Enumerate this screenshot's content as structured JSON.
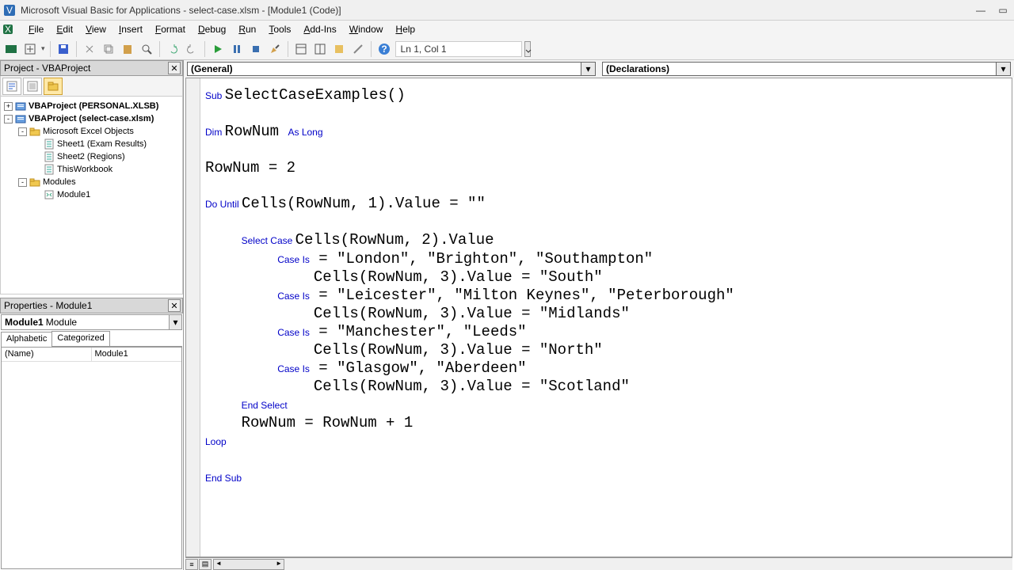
{
  "title": "Microsoft Visual Basic for Applications - select-case.xlsm - [Module1 (Code)]",
  "menus": [
    "File",
    "Edit",
    "View",
    "Insert",
    "Format",
    "Debug",
    "Run",
    "Tools",
    "Add-Ins",
    "Window",
    "Help"
  ],
  "cursor_position": "Ln 1, Col 1",
  "project_panel_title": "Project - VBAProject",
  "properties_panel_title": "Properties - Module1",
  "properties_object": {
    "name": "Module1",
    "type": "Module"
  },
  "properties_tabs": [
    "Alphabetic",
    "Categorized"
  ],
  "properties_rows": [
    {
      "key": "(Name)",
      "val": "Module1"
    }
  ],
  "tree": [
    {
      "indent": 0,
      "toggle": "+",
      "icon": "project",
      "label": "VBAProject (PERSONAL.XLSB)",
      "bold": true
    },
    {
      "indent": 0,
      "toggle": "-",
      "icon": "project",
      "label": "VBAProject (select-case.xlsm)",
      "bold": true
    },
    {
      "indent": 1,
      "toggle": "-",
      "icon": "folder",
      "label": "Microsoft Excel Objects",
      "bold": false
    },
    {
      "indent": 2,
      "toggle": "",
      "icon": "sheet",
      "label": "Sheet1 (Exam Results)",
      "bold": false
    },
    {
      "indent": 2,
      "toggle": "",
      "icon": "sheet",
      "label": "Sheet2 (Regions)",
      "bold": false
    },
    {
      "indent": 2,
      "toggle": "",
      "icon": "sheet",
      "label": "ThisWorkbook",
      "bold": false
    },
    {
      "indent": 1,
      "toggle": "-",
      "icon": "folder",
      "label": "Modules",
      "bold": false
    },
    {
      "indent": 2,
      "toggle": "",
      "icon": "module",
      "label": "Module1",
      "bold": false
    }
  ],
  "code_scope_left": "(General)",
  "code_scope_right": "(Declarations)",
  "code": {
    "lines": [
      [
        {
          "t": "Sub ",
          "k": true
        },
        {
          "t": "SelectCaseExamples()"
        }
      ],
      [
        {
          "t": ""
        }
      ],
      [
        {
          "t": "Dim ",
          "k": true
        },
        {
          "t": "RowNum "
        },
        {
          "t": "As Long",
          "k": true
        }
      ],
      [
        {
          "t": ""
        }
      ],
      [
        {
          "t": "RowNum = 2"
        }
      ],
      [
        {
          "t": ""
        }
      ],
      [
        {
          "t": "Do Until ",
          "k": true
        },
        {
          "t": "Cells(RowNum, 1).Value = \"\""
        }
      ],
      [
        {
          "t": ""
        }
      ],
      [
        {
          "t": "    "
        },
        {
          "t": "Select Case ",
          "k": true
        },
        {
          "t": "Cells(RowNum, 2).Value"
        }
      ],
      [
        {
          "t": "        "
        },
        {
          "t": "Case Is",
          "k": true
        },
        {
          "t": " = \"London\", \"Brighton\", \"Southampton\""
        }
      ],
      [
        {
          "t": "            Cells(RowNum, 3).Value = \"South\""
        }
      ],
      [
        {
          "t": "        "
        },
        {
          "t": "Case Is",
          "k": true
        },
        {
          "t": " = \"Leicester\", \"Milton Keynes\", \"Peterborough\""
        }
      ],
      [
        {
          "t": "            Cells(RowNum, 3).Value = \"Midlands\""
        }
      ],
      [
        {
          "t": "        "
        },
        {
          "t": "Case Is",
          "k": true
        },
        {
          "t": " = \"Manchester\", \"Leeds\""
        }
      ],
      [
        {
          "t": "            Cells(RowNum, 3).Value = \"North\""
        }
      ],
      [
        {
          "t": "        "
        },
        {
          "t": "Case Is",
          "k": true
        },
        {
          "t": " = \"Glasgow\", \"Aberdeen\""
        }
      ],
      [
        {
          "t": "            Cells(RowNum, 3).Value = \"Scotland\""
        }
      ],
      [
        {
          "t": "    "
        },
        {
          "t": "End Select",
          "k": true
        }
      ],
      [
        {
          "t": "    RowNum = RowNum + 1"
        }
      ],
      [
        {
          "t": "Loop",
          "k": true
        }
      ],
      [
        {
          "t": ""
        }
      ],
      [
        {
          "t": "End Sub",
          "k": true
        }
      ]
    ]
  }
}
